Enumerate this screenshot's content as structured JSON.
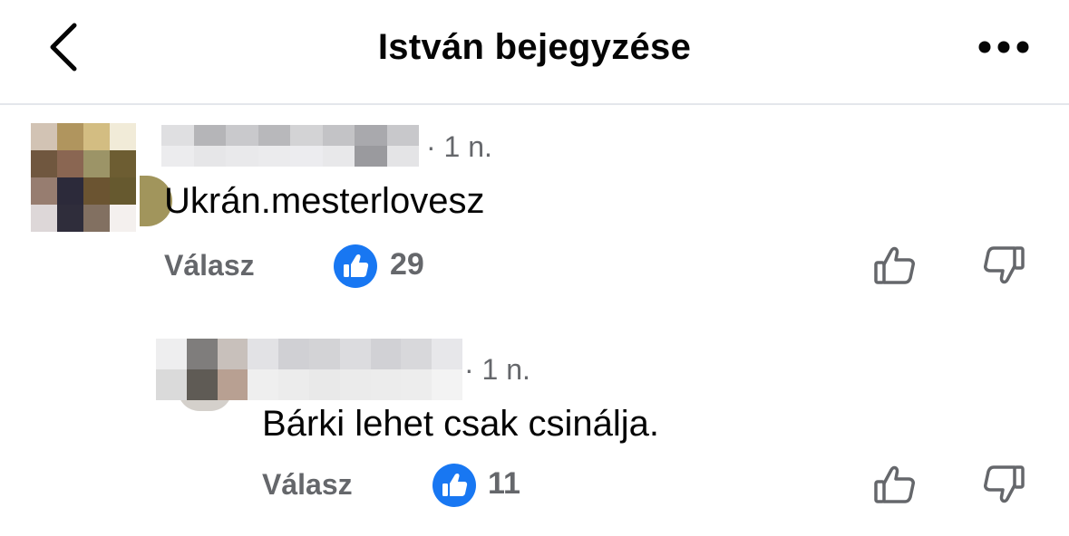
{
  "header": {
    "title": "István bejegyzése"
  },
  "comments": [
    {
      "time": "· 1 n.",
      "text": "Ukrán.mesterlovesz",
      "reply_label": "Válasz",
      "like_count": "29",
      "avatar_pixels": [
        "#d2c3b4",
        "#b0955e",
        "#d3bd82",
        "#f1ebd8",
        "#70573f",
        "#8a6652",
        "#9c9467",
        "#6d5d32",
        "#977d70",
        "#2c2a3a",
        "#6b5431",
        "#66592f",
        "#ddd7d8",
        "#2f2d3b",
        "#827061",
        "#f4f0ee"
      ],
      "name_pixels": [
        "#dfdfe1",
        "#b5b5b8",
        "#c9c9cc",
        "#b8b8bb",
        "#d3d3d5",
        "#c3c3c6",
        "#a9a9ad",
        "#c8c8cb",
        "#ececee",
        "#e6e6e8",
        "#e9e9eb",
        "#ebebed",
        "#ececef",
        "#e8e8ea",
        "#9a9a9e",
        "#e4e4e6"
      ]
    },
    {
      "time": "· 1 n.",
      "text": "Bárki lehet csak csinálja.",
      "reply_label": "Válasz",
      "like_count": "11",
      "name_pixels": [
        "#eeeeef",
        "#7f7d7c",
        "#c8c0bb",
        "#e2e2e5",
        "#d0d0d4",
        "#d3d3d6",
        "#dcdcdf",
        "#d1d1d5",
        "#d8d8db",
        "#e7e7ea",
        "#dadada",
        "#5f5b55",
        "#b8a092",
        "#efefef",
        "#ececec",
        "#e9e9e9",
        "#ebebeb",
        "#ececec",
        "#ededed",
        "#f3f3f3"
      ]
    }
  ],
  "colors": {
    "like_blue": "#1877f2",
    "secondary_text": "#65676b",
    "primary_text": "#050505",
    "divider": "#e4e6eb"
  },
  "icons": {
    "back": "chevron-left-icon",
    "more": "more-dots-icon",
    "like_badge": "thumbs-up-icon",
    "upvote": "thumbs-up-outline-icon",
    "downvote": "thumbs-down-outline-icon"
  }
}
